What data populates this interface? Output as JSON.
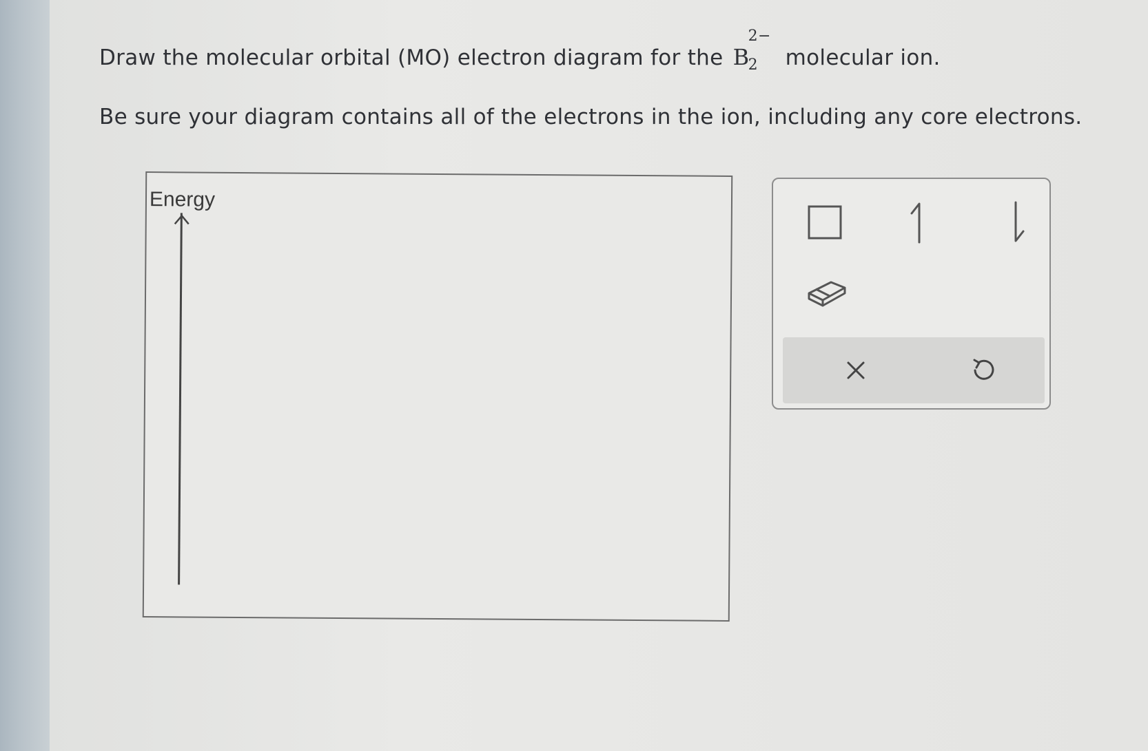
{
  "question": {
    "line1_before": "Draw the molecular orbital (MO) electron diagram for the",
    "formula_base": "B",
    "formula_sub": "2",
    "formula_sup": "2−",
    "line1_after": "molecular ion.",
    "line2": "Be sure your diagram contains all of the electrons in the ion, including any core electrons."
  },
  "diagram": {
    "axis_label": "Energy"
  },
  "toolbox": {
    "tools": [
      {
        "name": "orbital-box-tool",
        "icon": "square-outline-icon"
      },
      {
        "name": "spin-up-electron-tool",
        "icon": "half-arrow-up-icon"
      },
      {
        "name": "spin-down-electron-tool",
        "icon": "half-arrow-down-icon"
      },
      {
        "name": "eraser-tool",
        "icon": "eraser-icon"
      }
    ],
    "actions": [
      {
        "name": "clear-button",
        "icon": "x-icon"
      },
      {
        "name": "undo-button",
        "icon": "undo-icon"
      }
    ]
  }
}
